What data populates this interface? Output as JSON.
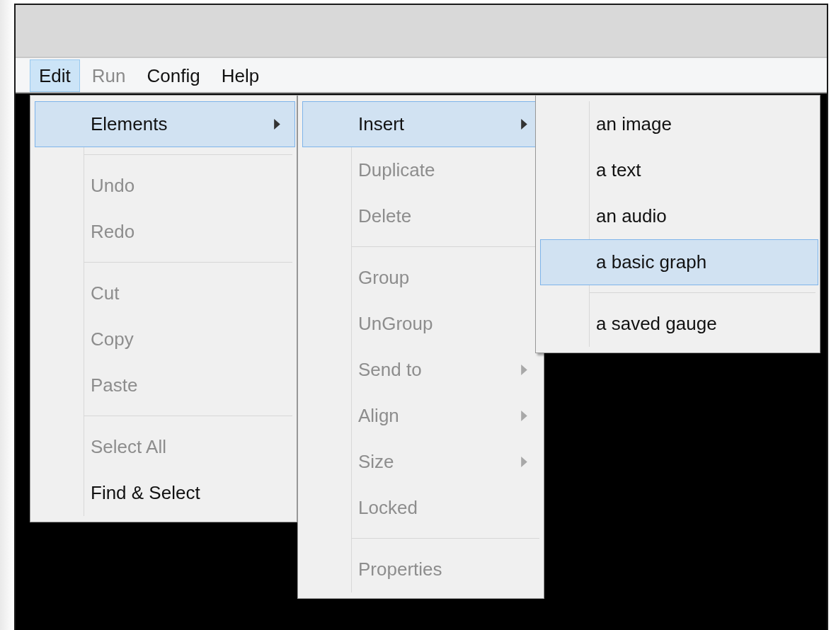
{
  "menubar": [
    {
      "label": "Edit",
      "selected": true,
      "disabled": false
    },
    {
      "label": "Run",
      "selected": false,
      "disabled": true
    },
    {
      "label": "Config",
      "selected": false,
      "disabled": false
    },
    {
      "label": "Help",
      "selected": false,
      "disabled": false
    }
  ],
  "menus": [
    {
      "items": [
        {
          "kind": "item",
          "label": "Elements",
          "disabled": false,
          "selected": true,
          "submenu": true
        },
        {
          "kind": "separator"
        },
        {
          "kind": "item",
          "label": "Undo",
          "disabled": true,
          "selected": false,
          "submenu": false
        },
        {
          "kind": "item",
          "label": "Redo",
          "disabled": true,
          "selected": false,
          "submenu": false
        },
        {
          "kind": "separator"
        },
        {
          "kind": "item",
          "label": "Cut",
          "disabled": true,
          "selected": false,
          "submenu": false
        },
        {
          "kind": "item",
          "label": "Copy",
          "disabled": true,
          "selected": false,
          "submenu": false
        },
        {
          "kind": "item",
          "label": "Paste",
          "disabled": true,
          "selected": false,
          "submenu": false
        },
        {
          "kind": "separator"
        },
        {
          "kind": "item",
          "label": "Select All",
          "disabled": true,
          "selected": false,
          "submenu": false
        },
        {
          "kind": "item",
          "label": "Find & Select",
          "disabled": false,
          "selected": false,
          "submenu": false
        }
      ]
    },
    {
      "items": [
        {
          "kind": "item",
          "label": "Insert",
          "disabled": false,
          "selected": true,
          "submenu": true
        },
        {
          "kind": "item",
          "label": "Duplicate",
          "disabled": true,
          "selected": false,
          "submenu": false
        },
        {
          "kind": "item",
          "label": "Delete",
          "disabled": true,
          "selected": false,
          "submenu": false
        },
        {
          "kind": "separator"
        },
        {
          "kind": "item",
          "label": "Group",
          "disabled": true,
          "selected": false,
          "submenu": false
        },
        {
          "kind": "item",
          "label": "UnGroup",
          "disabled": true,
          "selected": false,
          "submenu": false
        },
        {
          "kind": "item",
          "label": "Send to",
          "disabled": true,
          "selected": false,
          "submenu": true
        },
        {
          "kind": "item",
          "label": "Align",
          "disabled": true,
          "selected": false,
          "submenu": true
        },
        {
          "kind": "item",
          "label": "Size",
          "disabled": true,
          "selected": false,
          "submenu": true
        },
        {
          "kind": "item",
          "label": "Locked",
          "disabled": true,
          "selected": false,
          "submenu": false
        },
        {
          "kind": "separator"
        },
        {
          "kind": "item",
          "label": "Properties",
          "disabled": true,
          "selected": false,
          "submenu": false
        }
      ]
    },
    {
      "items": [
        {
          "kind": "item",
          "label": "an image",
          "disabled": false,
          "selected": false,
          "submenu": false
        },
        {
          "kind": "item",
          "label": "a text",
          "disabled": false,
          "selected": false,
          "submenu": false
        },
        {
          "kind": "item",
          "label": "an audio",
          "disabled": false,
          "selected": false,
          "submenu": false
        },
        {
          "kind": "item",
          "label": "a basic graph",
          "disabled": false,
          "selected": true,
          "submenu": false
        },
        {
          "kind": "separator"
        },
        {
          "kind": "item",
          "label": "a saved gauge",
          "disabled": false,
          "selected": false,
          "submenu": false
        }
      ]
    }
  ]
}
